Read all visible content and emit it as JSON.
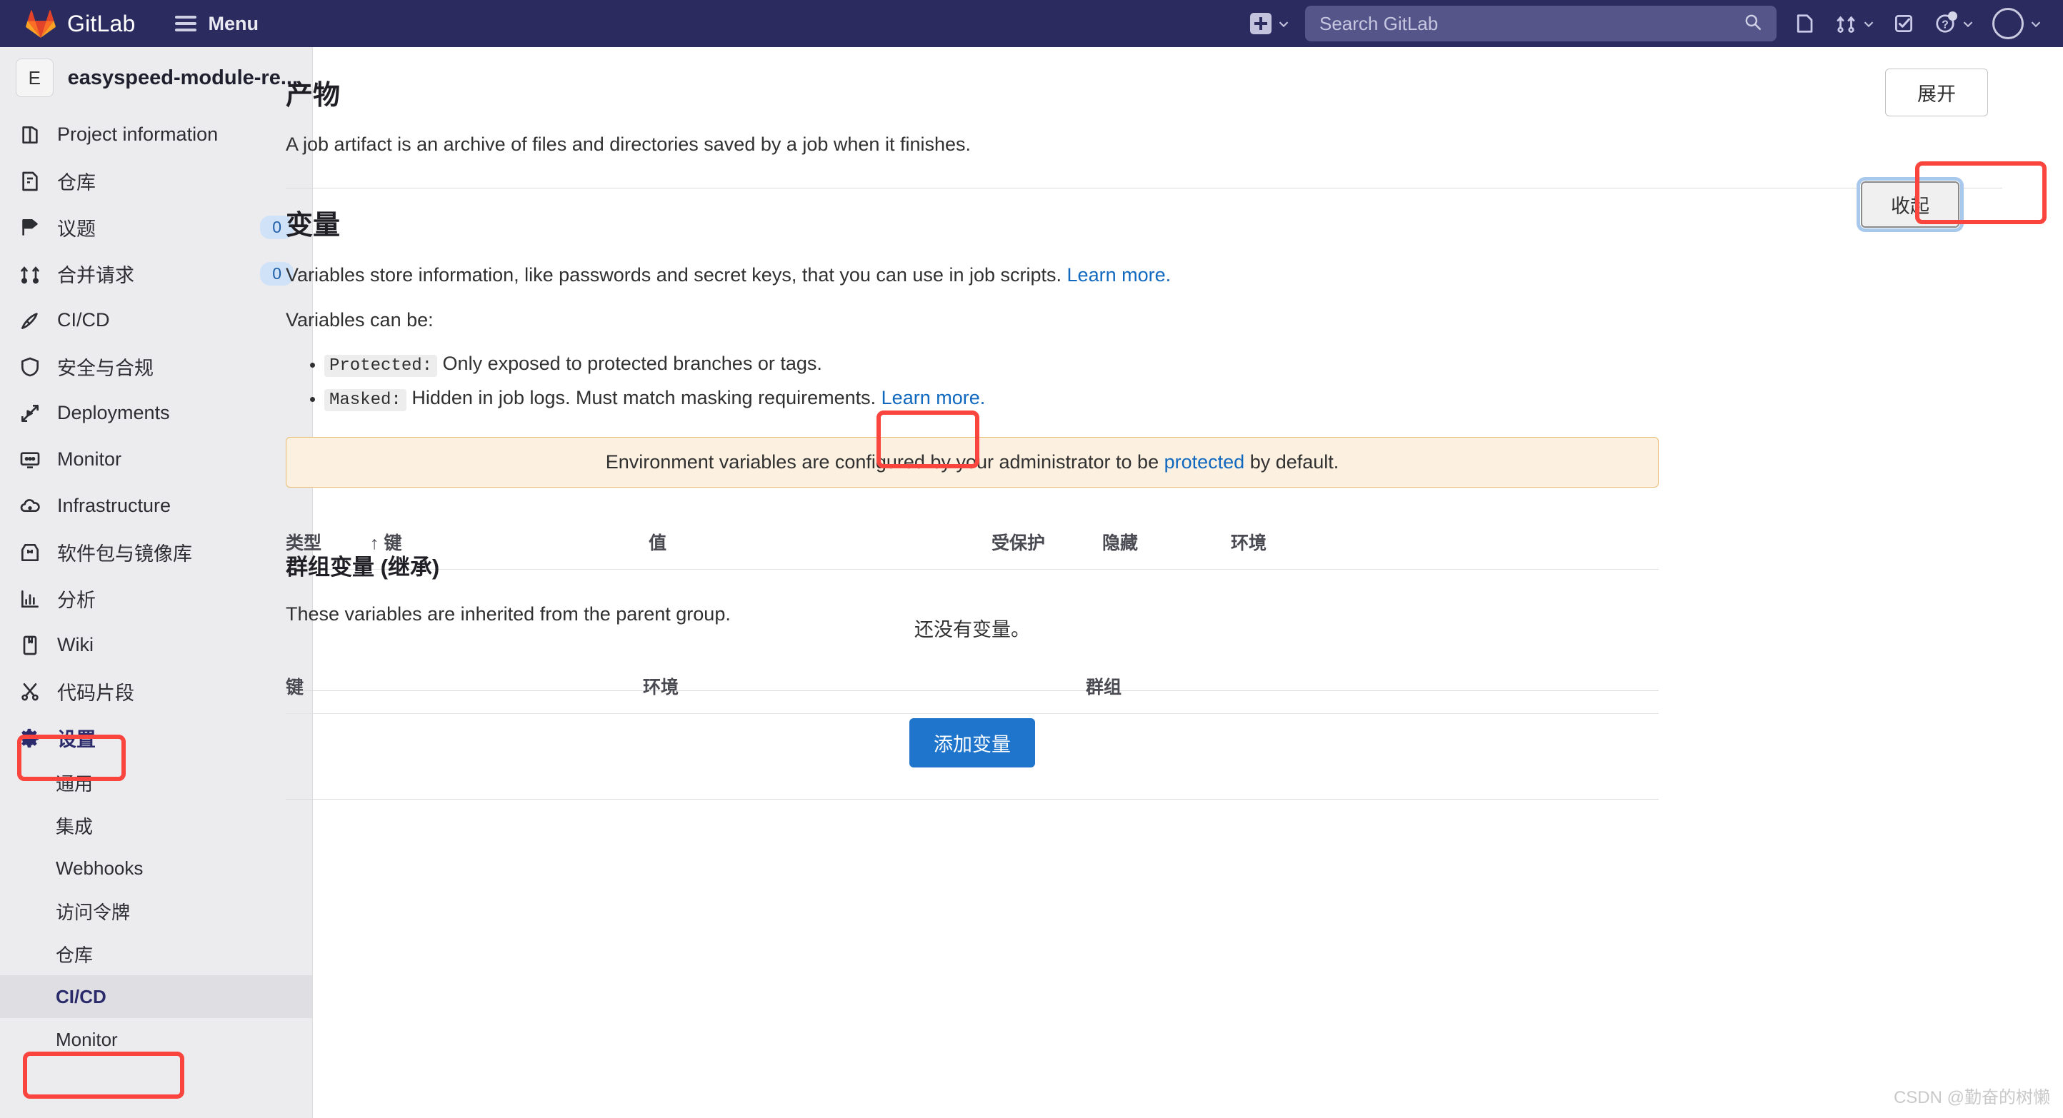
{
  "navbar": {
    "brand": "GitLab",
    "menu_label": "Menu",
    "logo_icon": "gitlab-tanuki-logo",
    "hamburger_icon": "hamburger-icon",
    "create_new_icon": "plus-square-icon",
    "create_new_chevron_icon": "chevron-down-icon",
    "search_placeholder": "Search GitLab",
    "search_icon": "search-icon",
    "issues_icon": "issues-icon",
    "merge_requests_icon": "merge-request-icon",
    "merge_requests_chevron_icon": "chevron-down-icon",
    "todos_icon": "todo-checkbox-icon",
    "help_icon": "question-circle-icon",
    "help_chevron_icon": "chevron-down-icon",
    "avatar_icon": "user-avatar",
    "avatar_chevron_icon": "chevron-down-icon",
    "bg_color": "#2b2b5f"
  },
  "sidebar": {
    "project_initial": "E",
    "project_name": "easyspeed-module-re...",
    "items": [
      {
        "label": "Project information",
        "icon": "project-information-icon",
        "badge": ""
      },
      {
        "label": "仓库",
        "icon": "repository-icon",
        "badge": ""
      },
      {
        "label": "议题",
        "icon": "issues-icon",
        "badge": "0"
      },
      {
        "label": "合并请求",
        "icon": "merge-request-icon",
        "badge": "0"
      },
      {
        "label": "CI/CD",
        "icon": "rocket-icon",
        "badge": ""
      },
      {
        "label": "安全与合规",
        "icon": "shield-icon",
        "badge": ""
      },
      {
        "label": "Deployments",
        "icon": "deployments-icon",
        "badge": ""
      },
      {
        "label": "Monitor",
        "icon": "monitor-icon",
        "badge": ""
      },
      {
        "label": "Infrastructure",
        "icon": "cloud-gear-icon",
        "badge": ""
      },
      {
        "label": "软件包与镜像库",
        "icon": "package-icon",
        "badge": ""
      },
      {
        "label": "分析",
        "icon": "chart-icon",
        "badge": ""
      },
      {
        "label": "Wiki",
        "icon": "wiki-book-icon",
        "badge": ""
      },
      {
        "label": "代码片段",
        "icon": "snippet-scissors-icon",
        "badge": ""
      }
    ],
    "settings": {
      "label": "设置",
      "icon": "gear-icon"
    },
    "sub_items": [
      {
        "label": "通用",
        "active": false
      },
      {
        "label": "集成",
        "active": false
      },
      {
        "label": "Webhooks",
        "active": false
      },
      {
        "label": "访问令牌",
        "active": false
      },
      {
        "label": "仓库",
        "active": false
      },
      {
        "label": "CI/CD",
        "active": true
      },
      {
        "label": "Monitor",
        "active": false
      }
    ],
    "highlight_color": "#f9453e"
  },
  "artifacts_section": {
    "title": "产物",
    "description": "A job artifact is an archive of files and directories saved by a job when it finishes.",
    "expand_button": "展开"
  },
  "variables_section": {
    "title": "变量",
    "collapse_button": "收起",
    "intro_text": "Variables store information, like passwords and secret keys, that you can use in job scripts.",
    "intro_link": "Learn more.",
    "can_be_text": "Variables can be:",
    "bullets": [
      {
        "code": "Protected:",
        "text": "Only exposed to protected branches or tags.",
        "link": ""
      },
      {
        "code": "Masked:",
        "text": "Hidden in job logs. Must match masking requirements.",
        "link": "Learn more."
      }
    ],
    "alert": {
      "prefix": "Environment variables are configured by your administrator to be",
      "link": "protected",
      "suffix": "by default.",
      "bg_color": "#fcf1e1",
      "border_color": "#e9be74"
    },
    "table_headers": [
      "类型",
      "↑ 键",
      "值",
      "受保护",
      "隐藏",
      "环境"
    ],
    "empty_message": "还没有变量。",
    "add_button": "添加变量",
    "add_button_color": "#1f75cb"
  },
  "group_variables_section": {
    "title": "群组变量 (继承)",
    "description": "These variables are inherited from the parent group.",
    "table_headers": [
      "键",
      "环境",
      "群组"
    ]
  },
  "watermark": "CSDN @勤奋的树懒"
}
